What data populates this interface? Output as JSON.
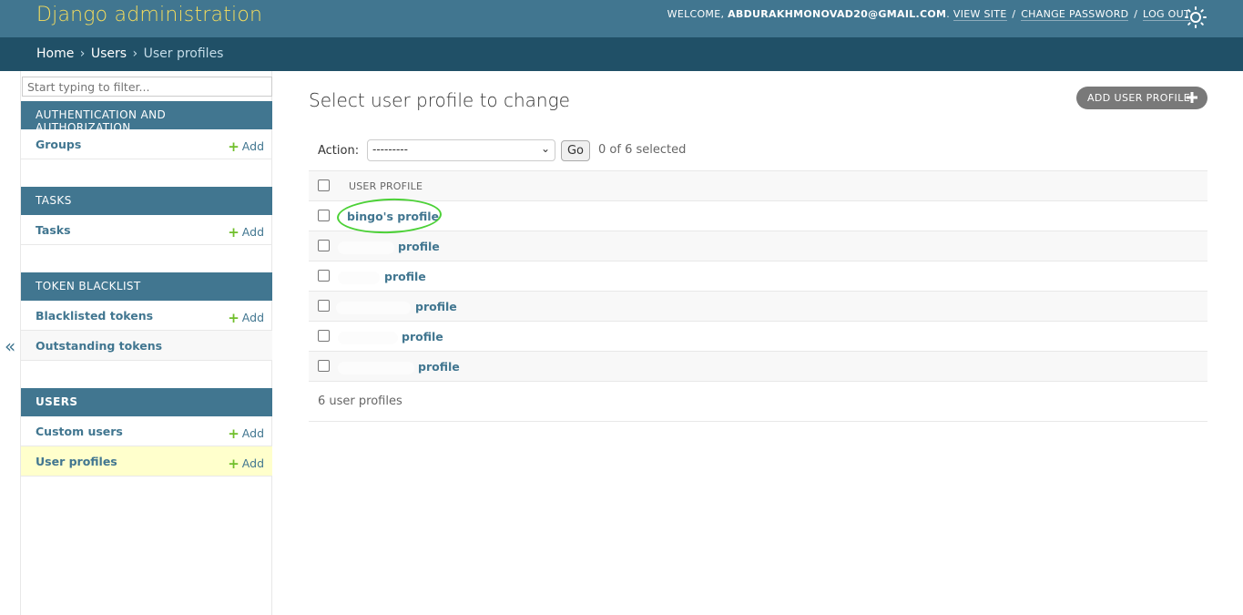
{
  "header": {
    "title": "Django administration",
    "welcome": "Welcome,",
    "user": "abdurakhmonovad20@gmail.com",
    "links": {
      "view_site": "View site",
      "change_password": "Change password",
      "log_out": "Log out"
    },
    "separator": "/"
  },
  "breadcrumbs": {
    "home": "Home",
    "users": "Users",
    "current": "User profiles",
    "arrow": "›"
  },
  "sidebar": {
    "filter_placeholder": "Start typing to filter...",
    "add_label": "Add",
    "toggle_glyph": "«",
    "modules": [
      {
        "caption": "Authentication and Authorization",
        "items": [
          {
            "label": "Groups"
          }
        ]
      },
      {
        "caption": "Tasks",
        "items": [
          {
            "label": "Tasks"
          }
        ]
      },
      {
        "caption": "Token Blacklist",
        "items": [
          {
            "label": "Blacklisted tokens"
          },
          {
            "label": "Outstanding tokens"
          }
        ]
      },
      {
        "caption": "Users",
        "items": [
          {
            "label": "Custom users"
          },
          {
            "label": "User profiles"
          }
        ]
      }
    ]
  },
  "content": {
    "title": "Select user profile to change",
    "add_button": "Add user profile",
    "action_label": "Action:",
    "action_value": "---------",
    "go_label": "Go",
    "selected": "0 of 6 selected",
    "column_header": "User profile",
    "rows": [
      "bingo's profile",
      "profile",
      "profile",
      "profile",
      "profile",
      "profile"
    ],
    "result_count": "6 user profiles"
  },
  "colors": {
    "header": "#417690",
    "breadcrumbs": "#205067",
    "branding": "#f5dd5d",
    "link": "#417690",
    "add_plus": "#70bf2b",
    "current_row": "#ffffcc",
    "highlight": "#4cd137"
  }
}
